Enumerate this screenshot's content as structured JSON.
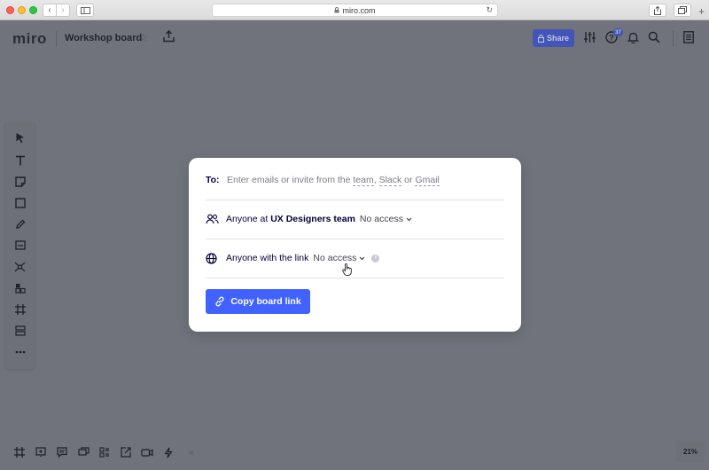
{
  "browser": {
    "url": "miro.com"
  },
  "app": {
    "logo": "miro",
    "board_name": "Workshop board",
    "share_label": "Share",
    "notification_badge": "37",
    "zoom": "21%"
  },
  "modal": {
    "to_label": "To:",
    "email_prefix": "Enter emails or invite from the ",
    "email_team": "team",
    "email_sep1": ", ",
    "email_slack": "Slack",
    "email_sep2": " or ",
    "email_gmail": "Gmail",
    "team_prefix": "Anyone at ",
    "team_name": "UX Designers team",
    "team_access": "No access",
    "link_label": "Anyone with the link",
    "link_access": "No access",
    "info": "i",
    "copy_button": "Copy board link"
  },
  "colors": {
    "canvas_overlay": "#70737b",
    "accent": "#4262ff",
    "share_button": "#4355b6"
  }
}
